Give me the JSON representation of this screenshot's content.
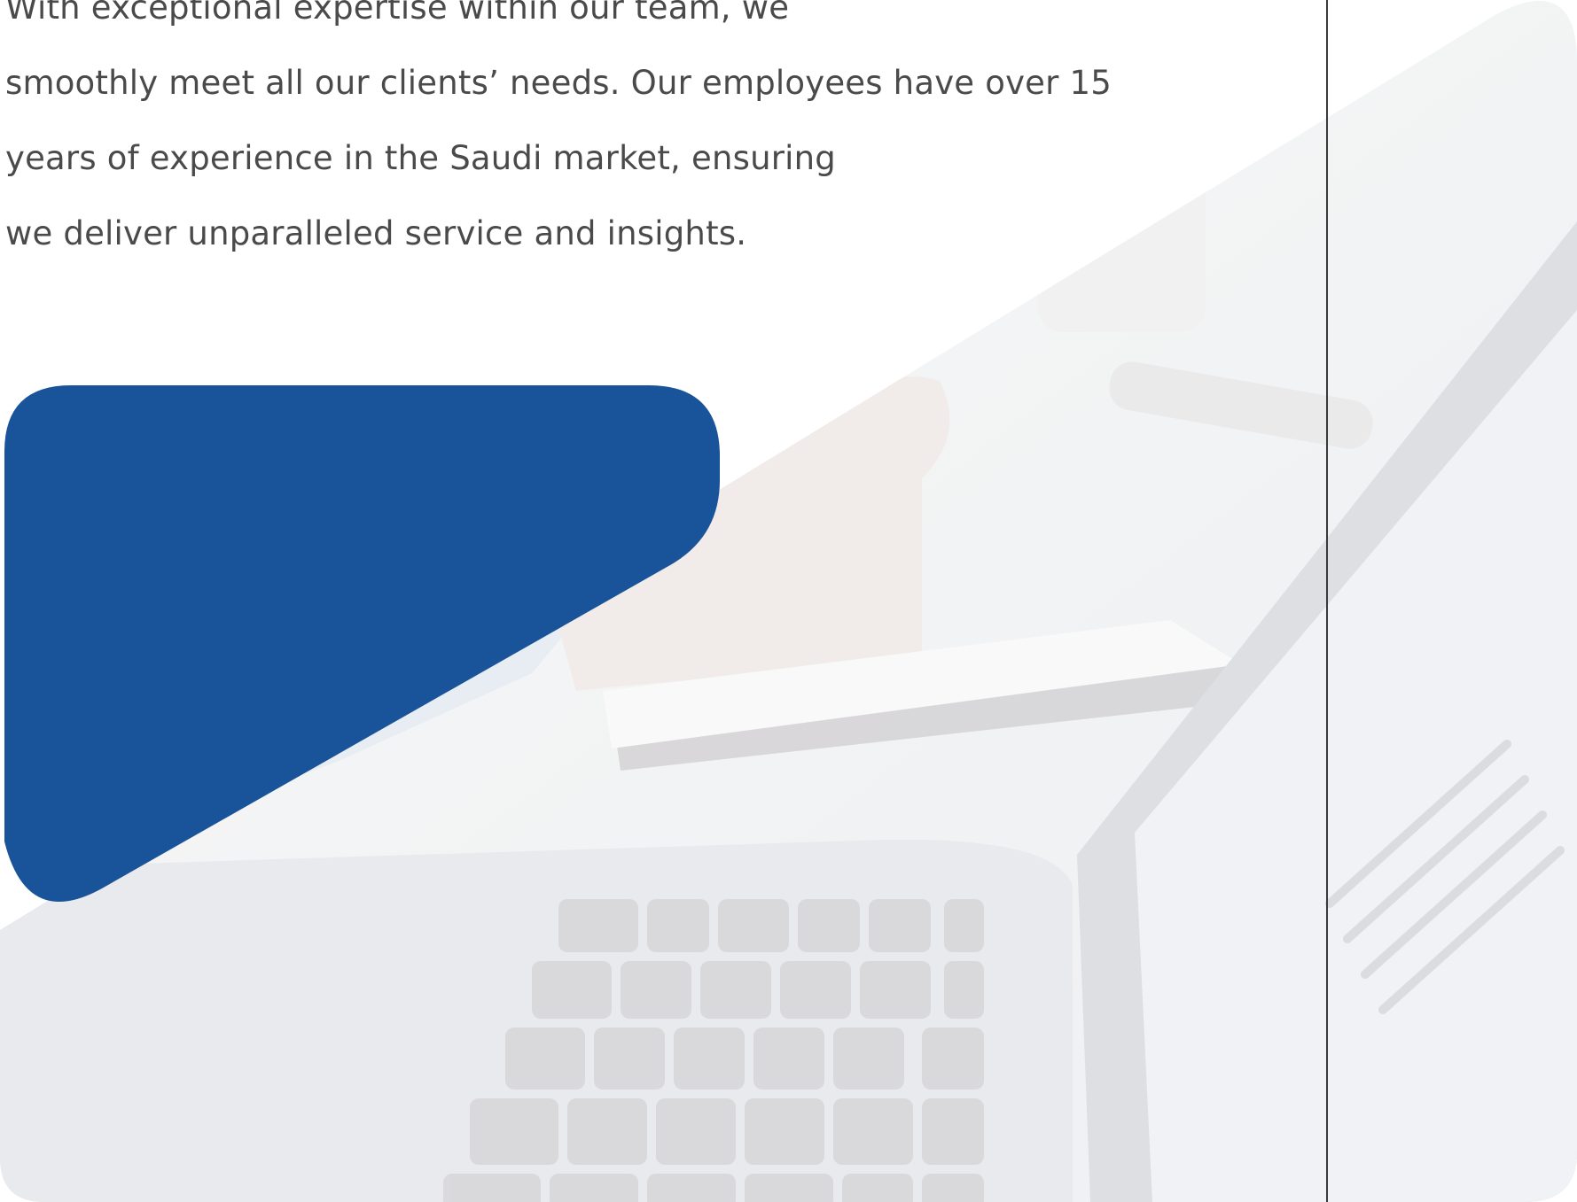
{
  "intro": {
    "lines": [
      "With exceptional expertise within our team, we",
      "smoothly meet all our clients’ needs. Our employees have over 15",
      "years of experience in the Saudi market, ensuring",
      "we deliver unparalleled service and insights."
    ]
  },
  "colors": {
    "accent": "#19539a",
    "text": "#4a4a4a",
    "divider": "#3a3a3a"
  }
}
